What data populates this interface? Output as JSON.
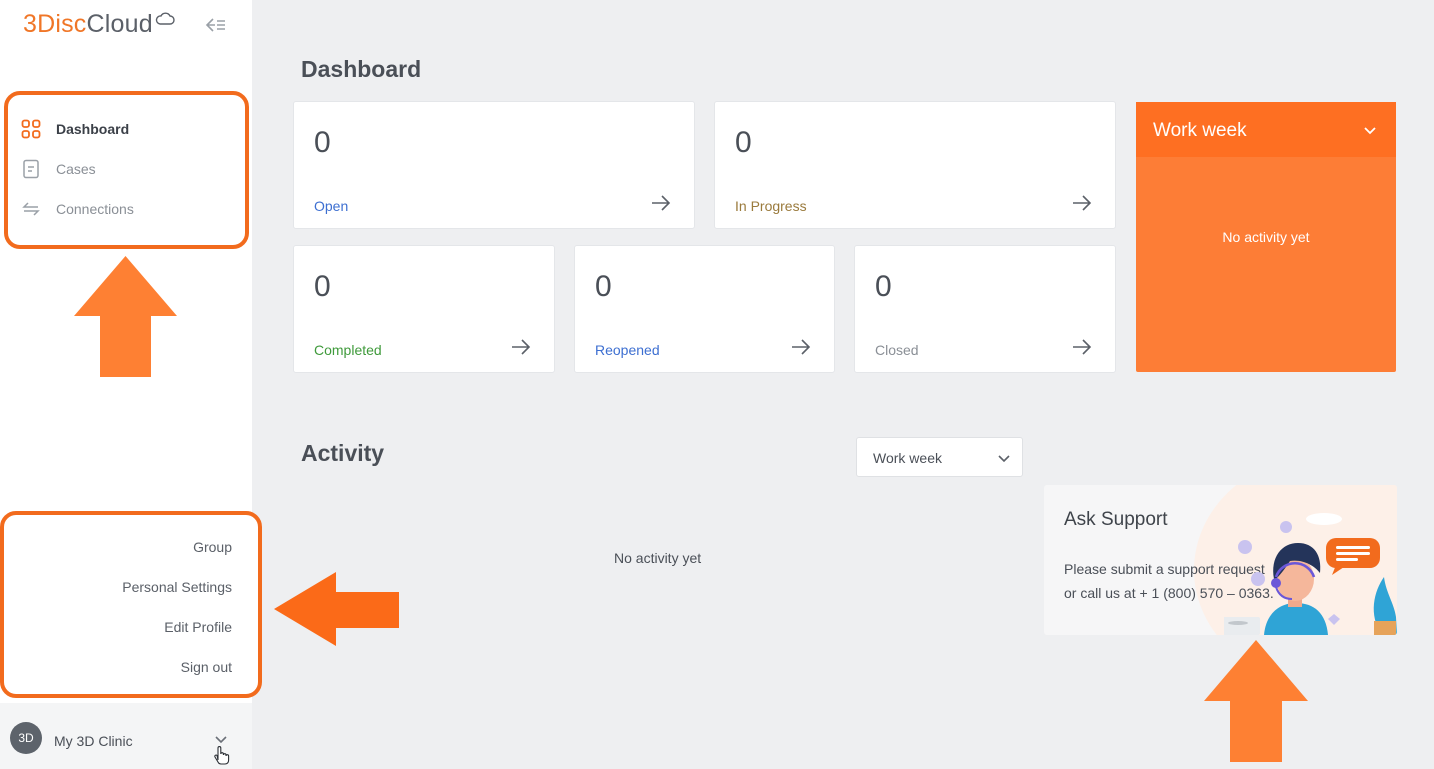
{
  "brand": {
    "part1": "3Disc",
    "part2": "Cloud"
  },
  "sidebar": {
    "nav": [
      {
        "label": "Dashboard",
        "icon": "grid-icon",
        "active": true
      },
      {
        "label": "Cases",
        "icon": "document-icon"
      },
      {
        "label": "Connections",
        "icon": "swap-arrows-icon"
      }
    ],
    "menu": [
      "Group",
      "Personal Settings",
      "Edit Profile",
      "Sign out"
    ],
    "account": {
      "initials": "3D",
      "name": "My 3D Clinic"
    }
  },
  "dashboard": {
    "title": "Dashboard",
    "stats": [
      {
        "value": "0",
        "label": "Open",
        "color": "#3d6fd1"
      },
      {
        "value": "0",
        "label": "In Progress",
        "color": "#9a7a3c"
      },
      {
        "value": "0",
        "label": "Completed",
        "color": "#3f9a3b"
      },
      {
        "value": "0",
        "label": "Reopened",
        "color": "#3d6fd1"
      },
      {
        "value": "0",
        "label": "Closed",
        "color": "#8a8f96"
      }
    ],
    "work_week": {
      "title": "Work week",
      "empty": "No activity yet"
    }
  },
  "activity": {
    "title": "Activity",
    "period": "Work week",
    "empty": "No activity yet"
  },
  "support": {
    "title": "Ask Support",
    "text": "Please submit a support request or call us at + 1 (800) 570 – 0363."
  },
  "colors": {
    "accent": "#f26b1d",
    "work_week_bg": "#fd7d36"
  }
}
